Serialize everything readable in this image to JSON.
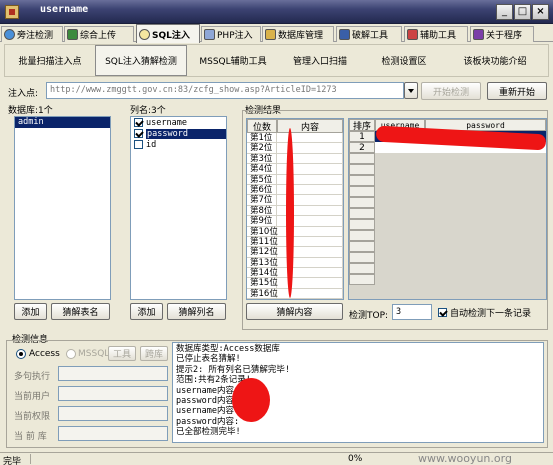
{
  "window": {
    "title": "username",
    "minimize": "_",
    "maximize": "□",
    "close": "×"
  },
  "tabs": [
    {
      "label": "旁注检测",
      "icon": "globe-icon"
    },
    {
      "label": "综合上传",
      "icon": "upload-icon"
    },
    {
      "label": "SQL注入",
      "icon": "search-icon"
    },
    {
      "label": "PHP注入",
      "icon": "php-icon"
    },
    {
      "label": "数据库管理",
      "icon": "database-icon"
    },
    {
      "label": "破解工具",
      "icon": "key-icon"
    },
    {
      "label": "辅助工具",
      "icon": "tool-icon"
    },
    {
      "label": "关于程序",
      "icon": "info-icon"
    }
  ],
  "subtabs": [
    "批量扫描注入点",
    "SQL注入猜解检测",
    "MSSQL辅助工具",
    "管理入口扫描",
    "检测设置区",
    "该板块功能介绍"
  ],
  "injection": {
    "label": "注入点:",
    "url": "http://www.zmggtt.gov.cn:83/zcfg_show.asp?ArticleID=1273",
    "start_button": "开始检测",
    "restart_button": "重新开始"
  },
  "database": {
    "label": "数据库:1个",
    "items": [
      "admin"
    ],
    "add_button": "添加",
    "guess_button": "猜解表名"
  },
  "columns": {
    "label": "列名:3个",
    "items": [
      {
        "name": "username",
        "checked": true,
        "selected": false
      },
      {
        "name": "password",
        "checked": true,
        "selected": true
      },
      {
        "name": "id",
        "checked": false,
        "selected": false
      }
    ],
    "add_button": "添加",
    "guess_button": "猜解列名"
  },
  "results": {
    "label": "检测结果",
    "position_header": "位数",
    "content_header": "内容",
    "positions": [
      "第1位",
      "第2位",
      "第3位",
      "第4位",
      "第5位",
      "第6位",
      "第7位",
      "第8位",
      "第9位",
      "第10位",
      "第11位",
      "第12位",
      "第13位",
      "第14位",
      "第15位",
      "第16位"
    ],
    "guess_content_button": "猜解内容",
    "table_headers": [
      "排序",
      "username",
      "password"
    ],
    "rows": [
      "1",
      "2"
    ],
    "top_label": "检测TOP:",
    "top_value": "3",
    "auto_label": "自动检测下一条记录",
    "auto_checked": true
  },
  "detect_info": {
    "label": "检测信息",
    "access_label": "Access",
    "mssql_label": "MSSQL",
    "tool_button": "工具",
    "cross_db_button": "跨库",
    "fields": [
      "多句执行",
      "当前用户",
      "当前权限",
      "当 前 库"
    ],
    "log_lines": [
      "数据库类型:Access数据库",
      "已停止表名猜解!",
      "提示2: 所有列名已猜解完毕!",
      "范围:共有2条记录!",
      "username内容:",
      "password内容:",
      "username内容:",
      "password内容:",
      "已全部检测完毕!"
    ]
  },
  "status": {
    "left": "完毕",
    "progress": "0%"
  },
  "watermark": "www.wooyun.org"
}
